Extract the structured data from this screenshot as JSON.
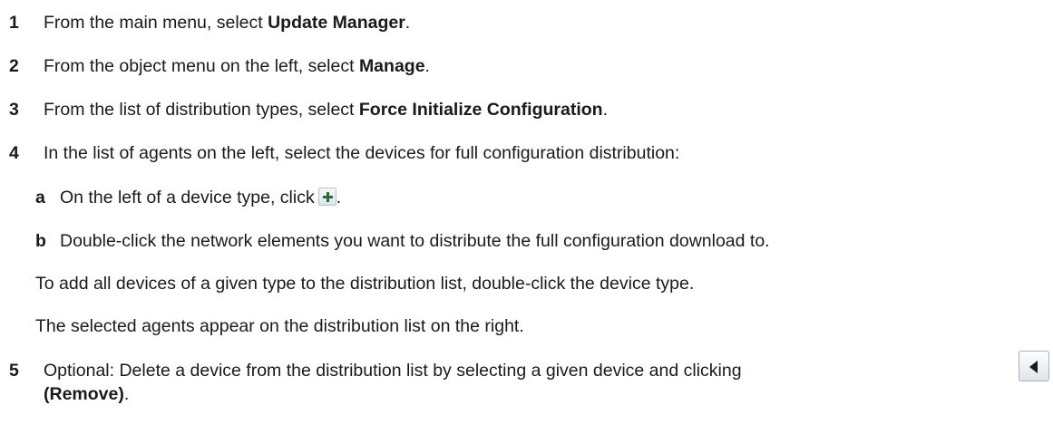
{
  "steps": [
    {
      "num": "1",
      "pre": "From the main menu, select ",
      "bold": "Update Manager",
      "post": "."
    },
    {
      "num": "2",
      "pre": "From the object menu on the left, select ",
      "bold": "Manage",
      "post": "."
    },
    {
      "num": "3",
      "pre": "From the list of distribution types, select ",
      "bold": "Force Initialize Configuration",
      "post": "."
    },
    {
      "num": "4",
      "text": "In the list of agents on the left, select the devices for full configuration distribution:"
    },
    {
      "num": "5",
      "pre": "Optional: Delete a device from the distribution list by selecting a given device and clicking",
      "bold2": "(Remove)",
      "post2": "."
    }
  ],
  "substeps": [
    {
      "letter": "a",
      "pre": "On the left of a device type, click",
      "post": ".",
      "icon": "plus-icon"
    },
    {
      "letter": "b",
      "text": "Double-click the network elements you want to distribute the full configuration download to."
    }
  ],
  "notes": [
    "To add all devices of a given type to the distribution list, double-click the device type.",
    "The selected agents appear on the distribution list on the right."
  ],
  "icons": {
    "expand": "plus-icon",
    "remove": "arrow-left-icon"
  }
}
